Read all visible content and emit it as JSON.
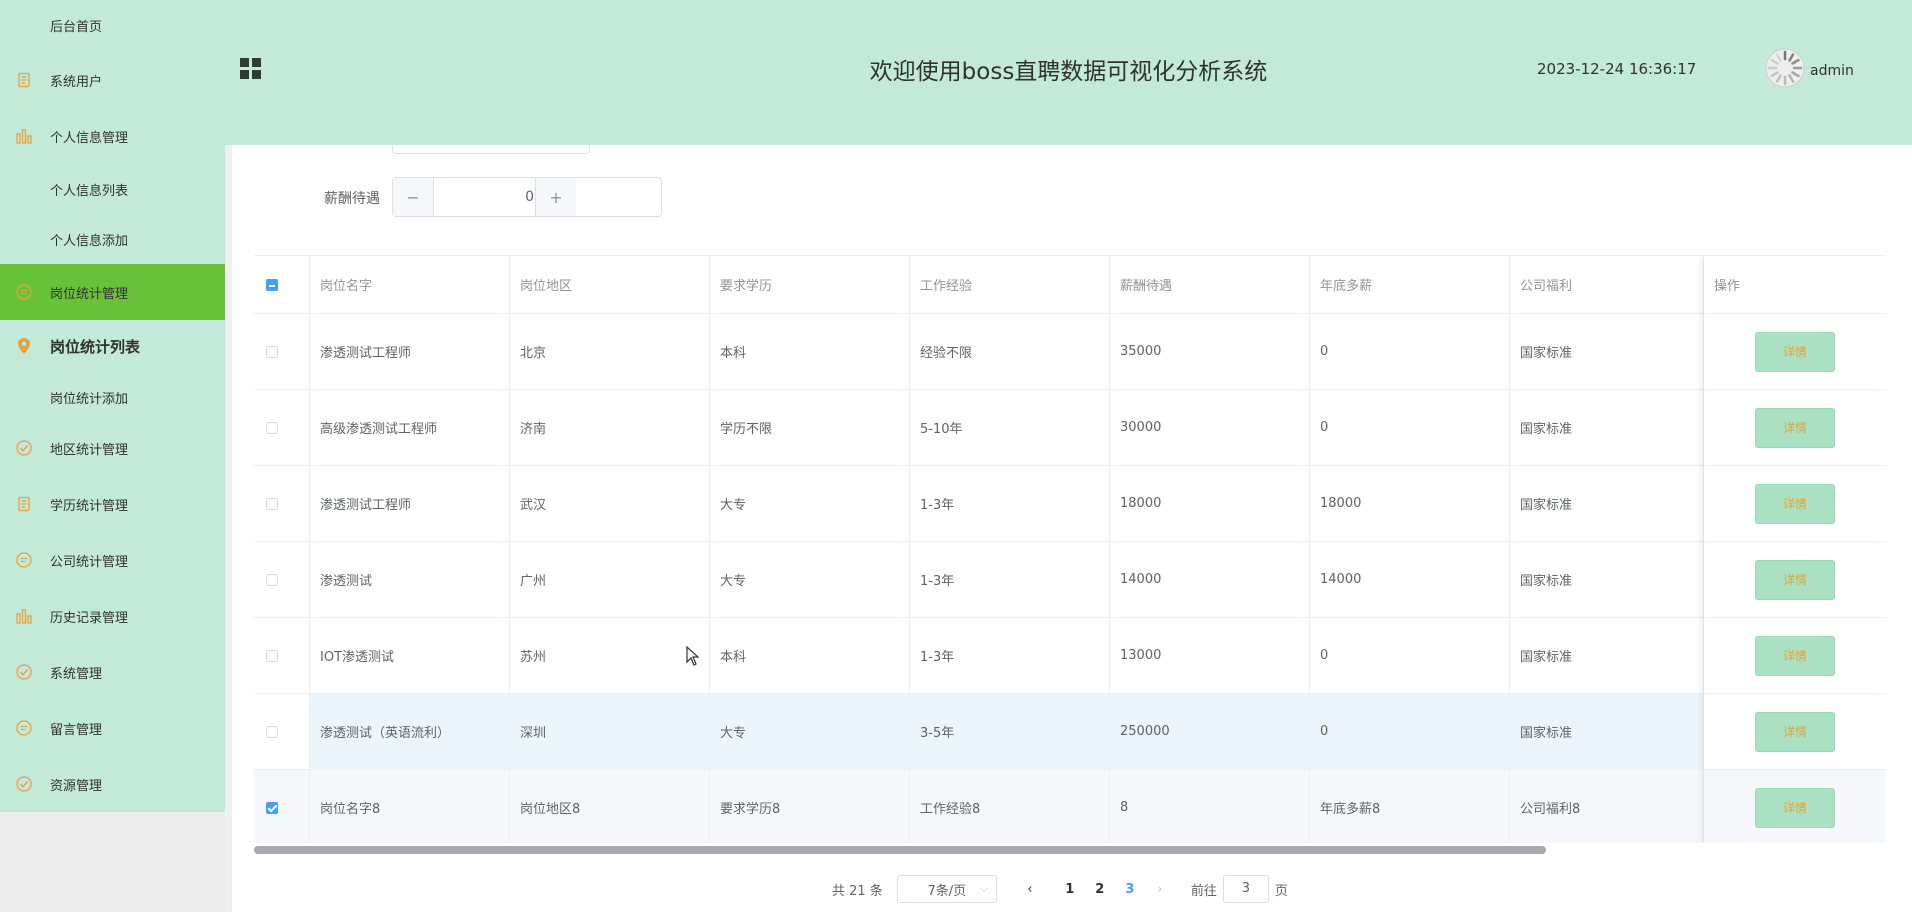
{
  "sidebar": {
    "items": [
      {
        "label": "后台首页",
        "icon": "none",
        "type": "sub"
      },
      {
        "label": "系统用户",
        "icon": "document-icon",
        "type": "item"
      },
      {
        "label": "个人信息管理",
        "icon": "bar-chart-icon",
        "type": "item"
      },
      {
        "label": "个人信息列表",
        "icon": "none",
        "type": "sub"
      },
      {
        "label": "个人信息添加",
        "icon": "none",
        "type": "sub"
      },
      {
        "label": "岗位统计管理",
        "icon": "chat-icon",
        "type": "active"
      },
      {
        "label": "岗位统计列表",
        "icon": "location-icon",
        "type": "current"
      },
      {
        "label": "岗位统计添加",
        "icon": "none",
        "type": "sub"
      },
      {
        "label": "地区统计管理",
        "icon": "check-circle-icon",
        "type": "item"
      },
      {
        "label": "学历统计管理",
        "icon": "document-icon",
        "type": "item"
      },
      {
        "label": "公司统计管理",
        "icon": "chat-icon",
        "type": "item"
      },
      {
        "label": "历史记录管理",
        "icon": "bar-chart-icon",
        "type": "item"
      },
      {
        "label": "系统管理",
        "icon": "check-circle-icon",
        "type": "item"
      },
      {
        "label": "留言管理",
        "icon": "chat-icon",
        "type": "item"
      },
      {
        "label": "资源管理",
        "icon": "check-circle-icon",
        "type": "item"
      }
    ]
  },
  "header": {
    "title": "欢迎使用boss直聘数据可视化分析系统",
    "datetime": "2023-12-24 16:36:17",
    "username": "admin"
  },
  "search": {
    "salary_label": "薪酬待遇",
    "salary_value": "0",
    "minus": "−",
    "plus": "+"
  },
  "table": {
    "headers": [
      "岗位名字",
      "岗位地区",
      "要求学历",
      "工作经验",
      "薪酬待遇",
      "年底多薪",
      "公司福利",
      "操作"
    ],
    "action_label": "详情",
    "rows": [
      {
        "cells": [
          "渗透测试工程师",
          "北京",
          "本科",
          "经验不限",
          "35000",
          "0",
          "国家标准"
        ],
        "checked": false,
        "highlight": false
      },
      {
        "cells": [
          "高级渗透测试工程师",
          "济南",
          "学历不限",
          "5-10年",
          "30000",
          "0",
          "国家标准"
        ],
        "checked": false,
        "highlight": false
      },
      {
        "cells": [
          "渗透测试工程师",
          "武汉",
          "大专",
          "1-3年",
          "18000",
          "18000",
          "国家标准"
        ],
        "checked": false,
        "highlight": false
      },
      {
        "cells": [
          "渗透测试",
          "广州",
          "大专",
          "1-3年",
          "14000",
          "14000",
          "国家标准"
        ],
        "checked": false,
        "highlight": false
      },
      {
        "cells": [
          "IOT渗透测试",
          "苏州",
          "本科",
          "1-3年",
          "13000",
          "0",
          "国家标准"
        ],
        "checked": false,
        "highlight": false
      },
      {
        "cells": [
          "渗透测试（英语流利）",
          "深圳",
          "大专",
          "3-5年",
          "250000",
          "0",
          "国家标准"
        ],
        "checked": false,
        "highlight": true
      },
      {
        "cells": [
          "岗位名字8",
          "岗位地区8",
          "要求学历8",
          "工作经验8",
          "8",
          "年底多薪8",
          "公司福利8"
        ],
        "checked": true,
        "highlight": false
      }
    ]
  },
  "pagination": {
    "total": "共 21 条",
    "page_size": "7条/页",
    "pages": [
      "1",
      "2",
      "3"
    ],
    "current": "3",
    "goto_prefix": "前往",
    "goto_value": "3",
    "goto_suffix": "页"
  },
  "colors": {
    "header_bg": "#c3ead8",
    "sidebar_bg": "#c3ead8",
    "active_bg": "#67c23a",
    "button_bg": "#a9e1c2",
    "button_text": "#e6a23c",
    "accent": "#409eff"
  }
}
